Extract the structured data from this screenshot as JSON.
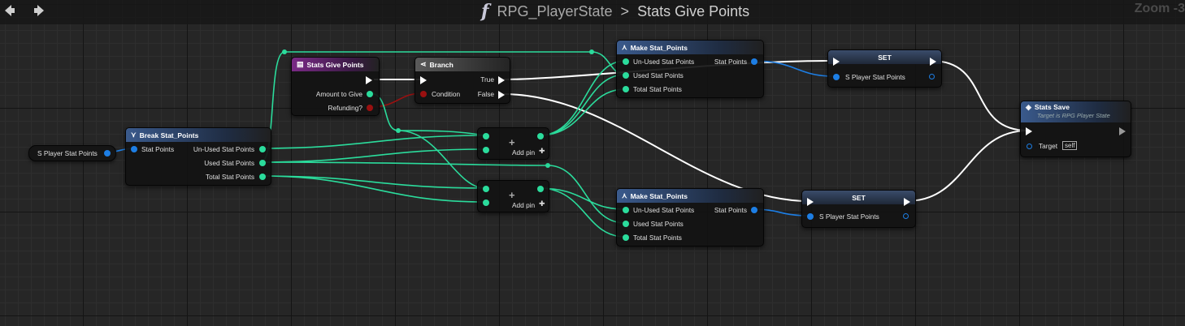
{
  "breadcrumb": {
    "function_icon": "f",
    "owner": "RPG_PlayerState",
    "separator": ">",
    "title": "Stats Give Points"
  },
  "zoom_label": "Zoom -3",
  "nodes": {
    "var_get": {
      "label": "S Player Stat Points"
    },
    "break": {
      "title": "Break Stat_Points",
      "in_pin": "Stat Points",
      "out_pins": [
        "Un-Used Stat Points",
        "Used Stat Points",
        "Total Stat Points"
      ]
    },
    "entry": {
      "title": "Stats Give Points",
      "pins": [
        "Amount to Give",
        "Refunding?"
      ]
    },
    "branch": {
      "title": "Branch",
      "in_pin": "Condition",
      "true_label": "True",
      "false_label": "False"
    },
    "add1": {
      "symbol": "+",
      "add_pin": "Add pin"
    },
    "add2": {
      "symbol": "+",
      "add_pin": "Add pin"
    },
    "make1": {
      "title": "Make Stat_Points",
      "in_pins": [
        "Un-Used Stat Points",
        "Used Stat Points",
        "Total Stat Points"
      ],
      "out_pin": "Stat Points"
    },
    "make2": {
      "title": "Make Stat_Points",
      "in_pins": [
        "Un-Used Stat Points",
        "Used Stat Points",
        "Total Stat Points"
      ],
      "out_pin": "Stat Points"
    },
    "set1": {
      "title": "SET",
      "pin": "S Player Stat Points"
    },
    "set2": {
      "title": "SET",
      "pin": "S Player Stat Points"
    },
    "save": {
      "title": "Stats Save",
      "subtitle": "Target is RPG Player State",
      "target_label": "Target",
      "target_value": "self"
    }
  },
  "colors": {
    "exec_wire": "#ffffff",
    "int_wire": "#2bdc9c",
    "struct_wire": "#1d7ee4",
    "bool_wire": "#9a1010"
  }
}
